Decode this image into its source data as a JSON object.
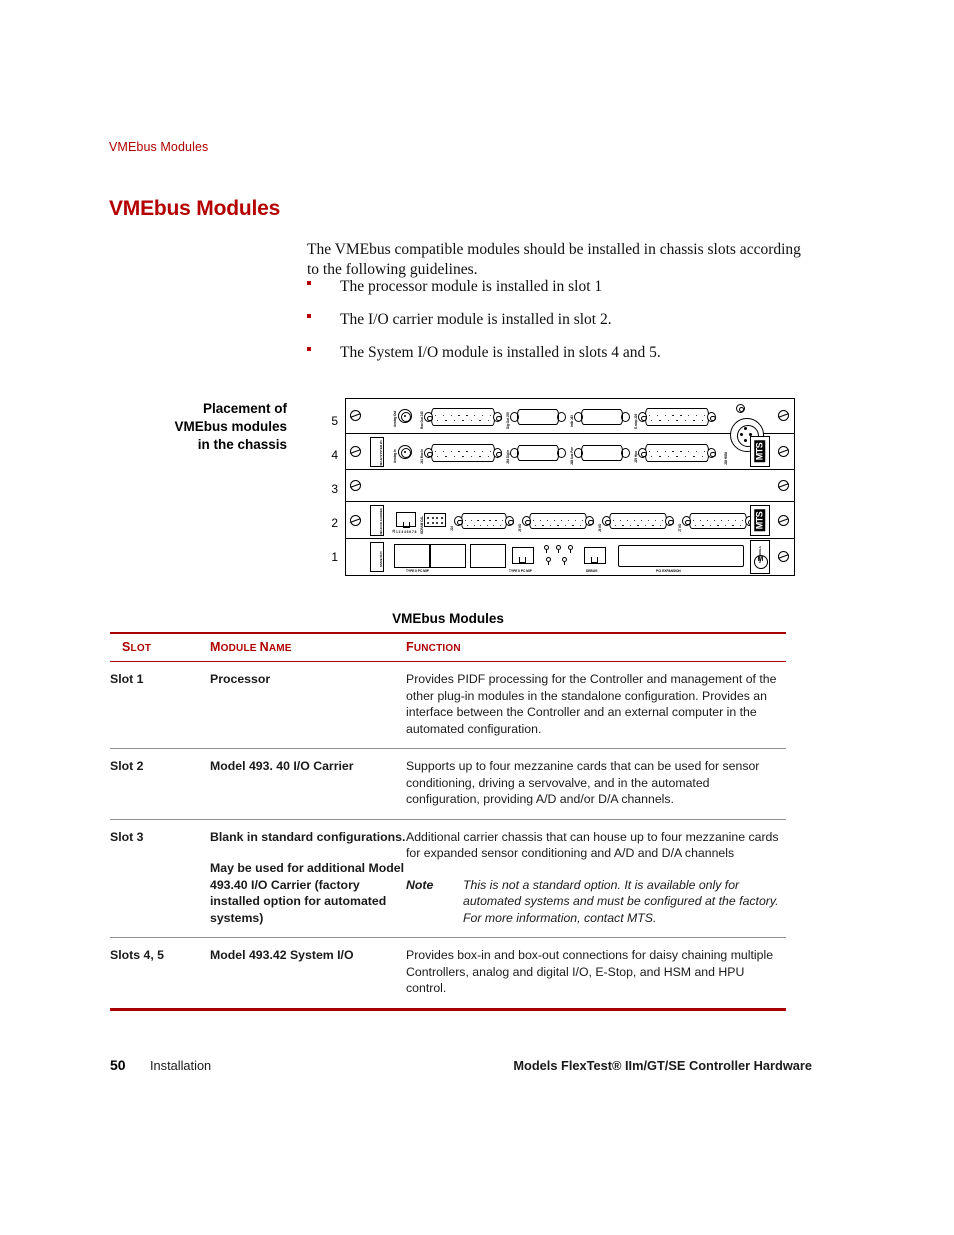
{
  "running_header": "VMEbus Modules",
  "heading": "VMEbus Modules",
  "intro": "The VMEbus compatible modules should be installed in chassis slots according to the following guidelines.",
  "bullets": [
    "The processor module is installed in slot 1",
    "The I/O carrier module is installed in slot 2.",
    "The System I/O module is installed in slots 4 and 5."
  ],
  "figure": {
    "caption_line1": "Placement of",
    "caption_line2": "VMEbus modules",
    "caption_line3": "in the chassis",
    "slot_numbers": [
      "5",
      "4",
      "3",
      "2",
      "1"
    ],
    "module_plates": {
      "slot45": "493.42 SYSTEM I/O",
      "slot2": "493.40 I/O CARRIER",
      "slot1": "MVME 5100"
    },
    "connector_labels": {
      "analog_out": "Analog Out",
      "analog_in": "Analog In",
      "j40_box_out": "Box Out J40",
      "j41_box_in": "J41 Box In",
      "j55_dig_out": "Dig Out J55",
      "j54_dig_in": "J54 Dig In",
      "j43_intlk": "Intlk  J43",
      "j48_aux_pwr": "J48 Aux Pwr",
      "j26_estop": "E-stop J26",
      "j25_hpu": "J25 Hpu",
      "j28_hsm": "J28 HSM",
      "j3": "J3",
      "scram_cal": "SCRAM CAL",
      "j10": "J10",
      "j5_io": "J5 I/O",
      "j6_io": "J6 I/O",
      "j7_io": "J7 I/O",
      "type2_pc_mip": "TYPE II PC MIP",
      "type2_pc_mip2": "TYPE II PC MIP",
      "debug": "DEBUG",
      "pci_expansion": "PCI EXPANSION",
      "motorola": "MOTOROLA"
    },
    "brand_plates": [
      "MTS",
      "MTS"
    ]
  },
  "table": {
    "title": "VMEbus Modules",
    "headers": {
      "slot": {
        "cap": "S",
        "rest": "LOT"
      },
      "module": {
        "cap1": "M",
        "rest1": "ODULE ",
        "cap2": "N",
        "rest2": "AME"
      },
      "function": {
        "cap": "F",
        "rest": "UNCTION"
      }
    },
    "rows": [
      {
        "slot": "Slot 1",
        "module": [
          "Processor"
        ],
        "function": [
          "Provides PIDF processing for the Controller and management of the other plug-in modules in the standalone configuration. Provides an interface between the Controller and an external computer in the automated configuration."
        ],
        "note": null
      },
      {
        "slot": "Slot 2",
        "module": [
          "Model 493. 40 I/O Carrier"
        ],
        "function": [
          "Supports up to four mezzanine cards that can be used for sensor conditioning, driving a servovalve, and in the automated configuration, providing A/D and/or D/A channels."
        ],
        "note": null
      },
      {
        "slot": "Slot 3",
        "module": [
          "Blank in standard configurations.",
          "May be used for additional Model 493.40 I/O Carrier (factory installed option for automated systems)"
        ],
        "function": [
          "Additional carrier chassis that can house up to four mezzanine cards for expanded sensor conditioning and A/D and D/A channels"
        ],
        "note": {
          "label": "Note",
          "text": "This is not a standard option. It is available only for automated systems and must be configured at the factory. For more information, contact MTS."
        }
      },
      {
        "slot": "Slots 4, 5",
        "module": [
          "Model 493.42 System I/O"
        ],
        "function": [
          "Provides box-in and box-out connections for daisy chaining multiple Controllers, analog and digital I/O, E-Stop, and HSM and HPU control."
        ],
        "note": null
      }
    ]
  },
  "footer": {
    "page_number": "50",
    "section": "Installation",
    "document_title": "Models FlexTest® IIm/GT/SE Controller Hardware"
  },
  "colors": {
    "accent_red": "#b00000",
    "heading_red": "#b50000",
    "rule_red": "#a80000",
    "rule_gray": "#8f8f8f",
    "text": "#101010"
  }
}
